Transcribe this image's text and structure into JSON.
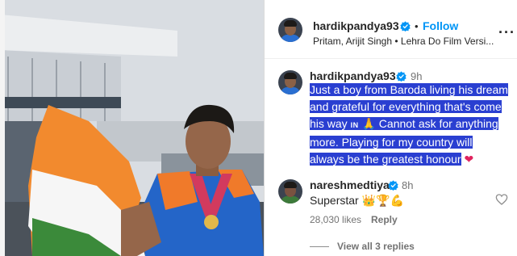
{
  "post": {
    "author": "hardikpandya93",
    "follow_label": "Follow",
    "dot": "•",
    "audio": "Pritam, Arijit Singh • Lehra Do Film Versi...",
    "more_label": "···"
  },
  "caption": {
    "author": "hardikpandya93",
    "time": "9h",
    "line1": "Just a boy from Baroda living his dream",
    "line2": "and grateful for everything that's come",
    "line3_a": "his way",
    "line3_in": "IN",
    "line3_emoji": "🙏",
    "line3_b": "Cannot ask for anything",
    "line4": "more. Playing for my country will",
    "line5": "always be the greatest honour",
    "line5_emoji": "❤"
  },
  "comment": {
    "author": "nareshmedtiya",
    "time": "8h",
    "text": "Superstar",
    "emojis": "👑🏆💪",
    "likes": "28,030 likes",
    "reply_label": "Reply",
    "view_replies": "View all 3 replies"
  },
  "colors": {
    "accent": "#0095f6",
    "highlight": "#2a3fd1",
    "verified": "#0095f6"
  }
}
